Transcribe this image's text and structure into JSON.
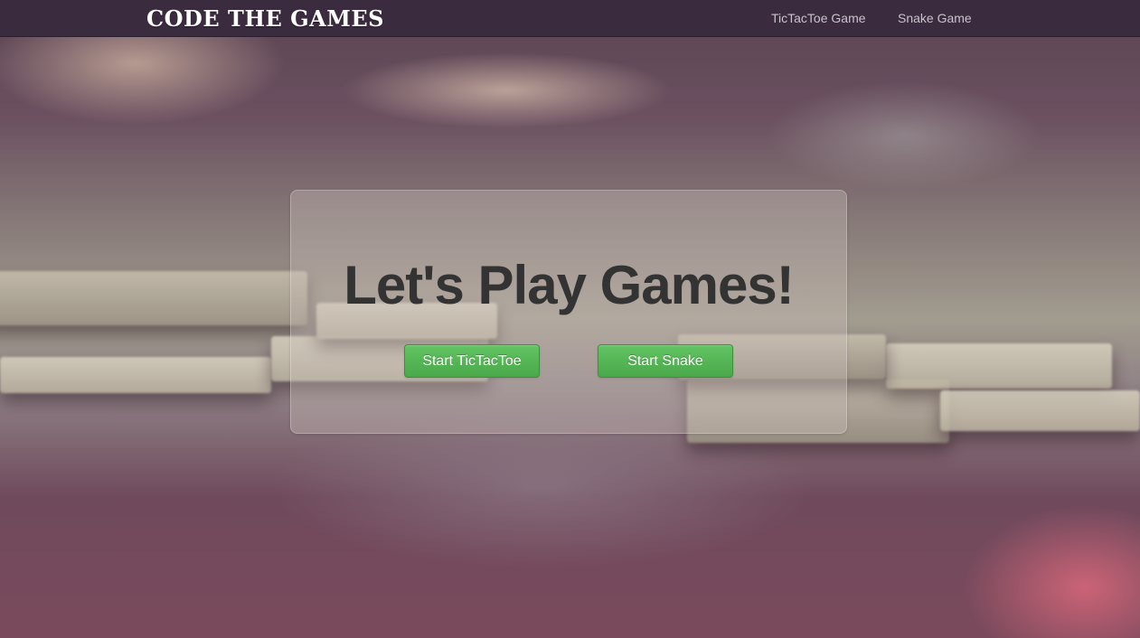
{
  "navbar": {
    "brand": "CODE THE GAMES",
    "links": [
      {
        "label": "TicTacToe Game"
      },
      {
        "label": "Snake Game"
      }
    ]
  },
  "hero": {
    "headline": "Let's Play Games!",
    "buttons": [
      {
        "label": "Start TicTacToe"
      },
      {
        "label": "Start Snake"
      }
    ]
  },
  "colors": {
    "navbar_bg": "#3a2b3e",
    "button_green": "#5cb85c",
    "headline_text": "#333333"
  }
}
